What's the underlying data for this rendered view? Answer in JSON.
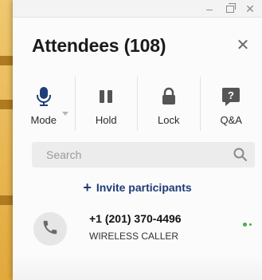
{
  "window": {
    "minimize_glyph": "–",
    "close_glyph": "✕"
  },
  "header": {
    "title": "Attendees (108)",
    "close_glyph": "✕"
  },
  "toolbar": {
    "items": [
      {
        "label": "Mode",
        "icon": "microphone-icon",
        "color": "#1f3f7a"
      },
      {
        "label": "Hold",
        "icon": "hold-icon",
        "color": "#555555"
      },
      {
        "label": "Lock",
        "icon": "lock-icon",
        "color": "#555555"
      },
      {
        "label": "Q&A",
        "icon": "question-bubble-icon",
        "color": "#555555"
      }
    ]
  },
  "search": {
    "placeholder": "Search",
    "icon": "search-icon"
  },
  "invite": {
    "plus_glyph": "+",
    "label": "Invite participants",
    "color": "#1e3c78"
  },
  "attendees": [
    {
      "name": "+1 (201) 370-4496",
      "subtitle": "WIRELESS CALLER",
      "icon": "phone-icon",
      "status_color": "#3fb24a"
    }
  ]
}
